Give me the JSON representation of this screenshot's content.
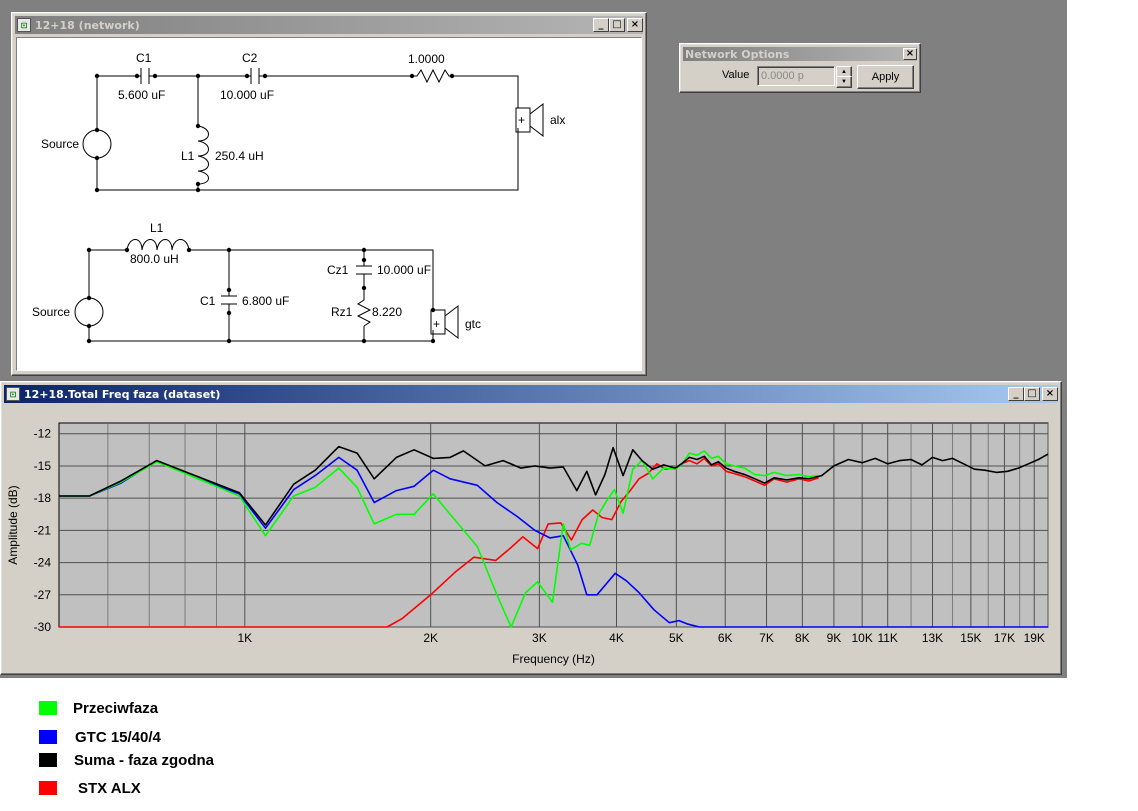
{
  "network_window": {
    "title": "12+18 (network)",
    "upper": {
      "source_label": "Source",
      "c1_name": "C1",
      "c1_value": "5.600 uF",
      "c2_name": "C2",
      "c2_value": "10.000 uF",
      "r_value": "1.0000",
      "l1_name": "L1",
      "l1_value": "250.4 uH",
      "speaker_plus": "+",
      "speaker_name": "alx"
    },
    "lower": {
      "source_label": "Source",
      "l1_name": "L1",
      "l1_value": "800.0 uH",
      "c1_name": "C1",
      "c1_value": "6.800 uF",
      "cz1_name": "Cz1",
      "cz1_value": "10.000 uF",
      "rz1_name": "Rz1",
      "rz1_value": "8.220",
      "speaker_plus": "+",
      "speaker_name": "gtc"
    }
  },
  "options_window": {
    "title": "Network Options",
    "value_label": "Value",
    "value_field": "0.0000 p",
    "apply_label": "Apply"
  },
  "graph_window": {
    "title": "12+18.Total Freq faza (dataset)"
  },
  "window_buttons": {
    "minimize": "_",
    "maximize": "□",
    "close": "×"
  },
  "colors": {
    "green": "#00ff00",
    "blue": "#0000ff",
    "black": "#000000",
    "red": "#ff0000",
    "plot_bg": "#c0c0c0",
    "title_active": "#0a246a"
  },
  "chart_data": {
    "type": "line",
    "xlabel": "Frequency (Hz)",
    "ylabel": "Amplitude (dB)",
    "x_scale": "log",
    "xlim": [
      500,
      20000
    ],
    "ylim": [
      -30,
      -11
    ],
    "grid": true,
    "yticks": [
      -12,
      -15,
      -18,
      -21,
      -24,
      -27,
      -30
    ],
    "xticks": [
      {
        "v": 1000,
        "label": "1K"
      },
      {
        "v": 2000,
        "label": "2K"
      },
      {
        "v": 3000,
        "label": "3K"
      },
      {
        "v": 4000,
        "label": "4K"
      },
      {
        "v": 5000,
        "label": "5K"
      },
      {
        "v": 6000,
        "label": "6K"
      },
      {
        "v": 7000,
        "label": "7K"
      },
      {
        "v": 8000,
        "label": "8K"
      },
      {
        "v": 9000,
        "label": "9K"
      },
      {
        "v": 10000,
        "label": "10K"
      },
      {
        "v": 11000,
        "label": "11K"
      },
      {
        "v": 13000,
        "label": "13K"
      },
      {
        "v": 15000,
        "label": "15K"
      },
      {
        "v": 17000,
        "label": "17K"
      },
      {
        "v": 19000,
        "label": "19K"
      }
    ],
    "minor_x": [
      600,
      700,
      800,
      900,
      12000,
      14000,
      16000,
      18000,
      20000
    ],
    "series": [
      {
        "name": "Przeciwfaza",
        "color": "#00ff00",
        "points": [
          [
            500,
            -17.8
          ],
          [
            560,
            -17.8
          ],
          [
            630,
            -16.5
          ],
          [
            720,
            -14.6
          ],
          [
            840,
            -16.2
          ],
          [
            980,
            -17.8
          ],
          [
            1080,
            -21.5
          ],
          [
            1200,
            -17.8
          ],
          [
            1300,
            -17.0
          ],
          [
            1420,
            -15.2
          ],
          [
            1520,
            -17.0
          ],
          [
            1620,
            -20.4
          ],
          [
            1760,
            -19.5
          ],
          [
            1880,
            -19.5
          ],
          [
            2020,
            -17.6
          ],
          [
            2150,
            -19.5
          ],
          [
            2380,
            -22.5
          ],
          [
            2560,
            -27.0
          ],
          [
            2700,
            -30.0
          ],
          [
            2850,
            -26.8
          ],
          [
            2980,
            -25.8
          ],
          [
            3150,
            -27.7
          ],
          [
            3280,
            -20.4
          ],
          [
            3370,
            -22.8
          ],
          [
            3510,
            -22.2
          ],
          [
            3620,
            -22.4
          ],
          [
            3740,
            -19.5
          ],
          [
            3860,
            -18.2
          ],
          [
            3970,
            -17.2
          ],
          [
            4100,
            -19.4
          ],
          [
            4250,
            -15.3
          ],
          [
            4400,
            -14.5
          ],
          [
            4580,
            -16.2
          ],
          [
            4770,
            -15.2
          ],
          [
            4980,
            -15.3
          ],
          [
            5100,
            -14.9
          ],
          [
            5250,
            -13.8
          ],
          [
            5400,
            -14.0
          ],
          [
            5550,
            -13.6
          ],
          [
            5700,
            -14.3
          ],
          [
            5850,
            -14.1
          ],
          [
            6020,
            -14.8
          ],
          [
            6200,
            -15.0
          ],
          [
            6450,
            -15.2
          ],
          [
            6700,
            -15.8
          ],
          [
            6950,
            -15.9
          ],
          [
            7200,
            -15.6
          ],
          [
            7550,
            -15.9
          ],
          [
            7900,
            -15.8
          ],
          [
            8200,
            -16.0
          ],
          [
            8500,
            -15.9
          ]
        ]
      },
      {
        "name": "GTC 15/40/4",
        "color": "#0000ff",
        "points": [
          [
            500,
            -17.8
          ],
          [
            560,
            -17.8
          ],
          [
            630,
            -16.6
          ],
          [
            720,
            -14.5
          ],
          [
            840,
            -16.2
          ],
          [
            980,
            -17.6
          ],
          [
            1080,
            -20.8
          ],
          [
            1200,
            -17.2
          ],
          [
            1300,
            -15.9
          ],
          [
            1420,
            -14.2
          ],
          [
            1520,
            -15.4
          ],
          [
            1620,
            -18.4
          ],
          [
            1760,
            -17.3
          ],
          [
            1880,
            -16.9
          ],
          [
            2020,
            -15.4
          ],
          [
            2150,
            -16.2
          ],
          [
            2380,
            -16.8
          ],
          [
            2560,
            -18.4
          ],
          [
            2760,
            -19.7
          ],
          [
            2950,
            -21.0
          ],
          [
            3120,
            -21.7
          ],
          [
            3280,
            -21.5
          ],
          [
            3460,
            -24.2
          ],
          [
            3580,
            -27.0
          ],
          [
            3720,
            -27.0
          ],
          [
            3860,
            -25.9
          ],
          [
            3980,
            -25.0
          ],
          [
            4150,
            -25.7
          ],
          [
            4350,
            -26.8
          ],
          [
            4600,
            -28.4
          ],
          [
            4870,
            -29.6
          ],
          [
            5050,
            -29.4
          ],
          [
            5200,
            -29.7
          ],
          [
            5450,
            -30.0
          ],
          [
            8500,
            -30.0
          ],
          [
            20000,
            -30.0
          ]
        ]
      },
      {
        "name": "Suma - faza zgodna",
        "color": "#000000",
        "points": [
          [
            500,
            -17.8
          ],
          [
            560,
            -17.8
          ],
          [
            630,
            -16.4
          ],
          [
            720,
            -14.5
          ],
          [
            840,
            -16.0
          ],
          [
            980,
            -17.5
          ],
          [
            1080,
            -20.5
          ],
          [
            1200,
            -16.7
          ],
          [
            1300,
            -15.4
          ],
          [
            1420,
            -13.2
          ],
          [
            1520,
            -13.8
          ],
          [
            1620,
            -16.2
          ],
          [
            1760,
            -14.2
          ],
          [
            1880,
            -13.5
          ],
          [
            2020,
            -14.3
          ],
          [
            2150,
            -14.2
          ],
          [
            2260,
            -13.6
          ],
          [
            2450,
            -15.0
          ],
          [
            2620,
            -14.5
          ],
          [
            2800,
            -15.2
          ],
          [
            2950,
            -15.0
          ],
          [
            3120,
            -15.2
          ],
          [
            3280,
            -15.1
          ],
          [
            3450,
            -17.3
          ],
          [
            3580,
            -15.5
          ],
          [
            3700,
            -17.7
          ],
          [
            3830,
            -15.8
          ],
          [
            3950,
            -13.3
          ],
          [
            4100,
            -15.9
          ],
          [
            4250,
            -13.5
          ],
          [
            4400,
            -14.5
          ],
          [
            4580,
            -15.3
          ],
          [
            4770,
            -14.9
          ],
          [
            4980,
            -15.2
          ],
          [
            5100,
            -14.8
          ],
          [
            5250,
            -14.2
          ],
          [
            5400,
            -14.4
          ],
          [
            5550,
            -14.1
          ],
          [
            5700,
            -14.9
          ],
          [
            5850,
            -14.6
          ],
          [
            6020,
            -15.2
          ],
          [
            6200,
            -15.5
          ],
          [
            6450,
            -15.8
          ],
          [
            6700,
            -16.2
          ],
          [
            6950,
            -16.6
          ],
          [
            7200,
            -16.1
          ],
          [
            7550,
            -16.3
          ],
          [
            7900,
            -16.1
          ],
          [
            8200,
            -16.2
          ],
          [
            8600,
            -15.9
          ],
          [
            9000,
            -15.0
          ],
          [
            9500,
            -14.4
          ],
          [
            10000,
            -14.7
          ],
          [
            10500,
            -14.3
          ],
          [
            11000,
            -14.8
          ],
          [
            11500,
            -14.5
          ],
          [
            12000,
            -14.4
          ],
          [
            12500,
            -14.9
          ],
          [
            13000,
            -14.2
          ],
          [
            13500,
            -14.5
          ],
          [
            14000,
            -14.3
          ],
          [
            14600,
            -14.8
          ],
          [
            15200,
            -15.3
          ],
          [
            15800,
            -15.4
          ],
          [
            16500,
            -15.6
          ],
          [
            17200,
            -15.5
          ],
          [
            17900,
            -15.2
          ],
          [
            18600,
            -14.8
          ],
          [
            19300,
            -14.4
          ],
          [
            20000,
            -13.9
          ]
        ]
      },
      {
        "name": "STX ALX",
        "color": "#ff0000",
        "points": [
          [
            500,
            -30.0
          ],
          [
            1700,
            -30.0
          ],
          [
            1800,
            -29.2
          ],
          [
            2000,
            -27.0
          ],
          [
            2200,
            -24.8
          ],
          [
            2350,
            -23.5
          ],
          [
            2550,
            -23.8
          ],
          [
            2700,
            -22.6
          ],
          [
            2820,
            -21.6
          ],
          [
            2980,
            -22.7
          ],
          [
            3100,
            -20.4
          ],
          [
            3250,
            -20.3
          ],
          [
            3380,
            -21.9
          ],
          [
            3520,
            -20.0
          ],
          [
            3660,
            -19.1
          ],
          [
            3790,
            -19.8
          ],
          [
            3930,
            -20.0
          ],
          [
            4070,
            -18.3
          ],
          [
            4210,
            -17.3
          ],
          [
            4350,
            -16.2
          ],
          [
            4500,
            -15.7
          ],
          [
            4650,
            -14.8
          ],
          [
            4800,
            -15.3
          ],
          [
            4980,
            -15.2
          ],
          [
            5100,
            -14.8
          ],
          [
            5250,
            -14.5
          ],
          [
            5400,
            -14.8
          ],
          [
            5550,
            -14.3
          ],
          [
            5700,
            -15.0
          ],
          [
            5850,
            -14.8
          ],
          [
            6020,
            -15.5
          ],
          [
            6200,
            -15.7
          ],
          [
            6450,
            -16.0
          ],
          [
            6700,
            -16.4
          ],
          [
            6950,
            -16.8
          ],
          [
            7200,
            -16.2
          ],
          [
            7550,
            -16.5
          ],
          [
            7900,
            -16.2
          ],
          [
            8200,
            -16.4
          ],
          [
            8500,
            -16.1
          ]
        ]
      }
    ]
  },
  "legend": [
    {
      "label": "Przeciwfaza",
      "color": "#00ff00"
    },
    {
      "label": "GTC 15/40/4",
      "color": "#0000ff"
    },
    {
      "label": "Suma - faza zgodna",
      "color": "#000000"
    },
    {
      "label": "STX ALX",
      "color": "#ff0000"
    }
  ]
}
